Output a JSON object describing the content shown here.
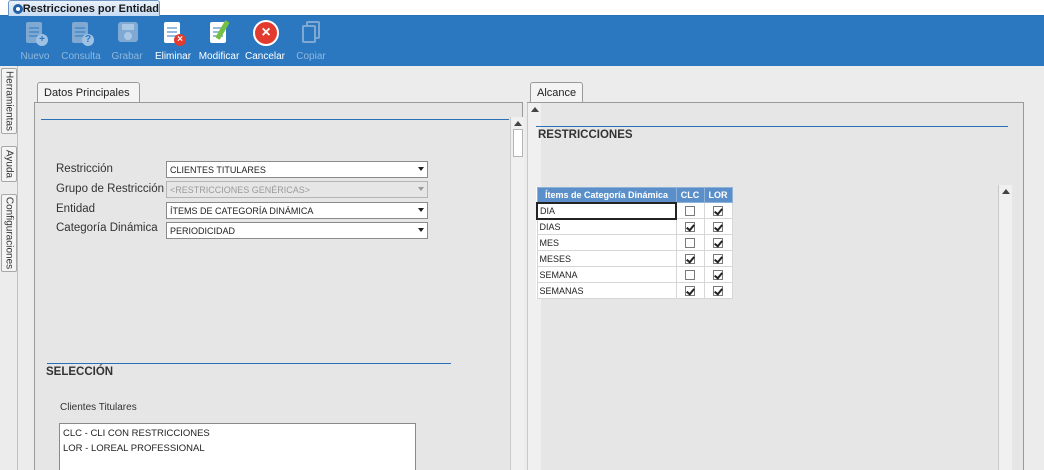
{
  "window": {
    "doc_tab_title": "Restricciones por Entidad"
  },
  "toolbar": {
    "buttons": [
      {
        "label": "Nuevo",
        "icon": "new-document-icon",
        "enabled": false
      },
      {
        "label": "Consulta",
        "icon": "query-document-icon",
        "enabled": false
      },
      {
        "label": "Grabar",
        "icon": "floppy-disk-icon",
        "enabled": false
      },
      {
        "label": "Eliminar",
        "icon": "delete-document-icon",
        "enabled": true
      },
      {
        "label": "Modificar",
        "icon": "edit-document-icon",
        "enabled": true
      },
      {
        "label": "Cancelar",
        "icon": "cancel-icon",
        "enabled": true
      },
      {
        "label": "Copiar",
        "icon": "copy-icon",
        "enabled": false
      }
    ],
    "colors": {
      "bar": "#2b78c0",
      "cancel": "#e23b2e"
    }
  },
  "side_tabs": [
    "Herramientas",
    "Ayuda",
    "Configuraciones"
  ],
  "left_panel": {
    "tab_label": "Datos Principales",
    "fields": {
      "restriccion": {
        "label": "Restricción",
        "value": "CLIENTES TITULARES"
      },
      "grupo": {
        "label": "Grupo de Restricción",
        "value": "<RESTRICCIONES GENÉRICAS>"
      },
      "entidad": {
        "label": "Entidad",
        "value": "ÍTEMS DE CATEGORÍA DINÁMICA"
      },
      "categoria": {
        "label": "Categoría Dinámica",
        "value": "PERIODICIDAD"
      }
    },
    "selection": {
      "title": "SELECCIÓN",
      "list_label": "Clientes Titulares",
      "items": [
        "CLC - CLI CON RESTRICCIONES",
        "LOR - LOREAL PROFESSIONAL"
      ]
    }
  },
  "right_panel": {
    "tab_label": "Alcance",
    "section_title": "RESTRICCIONES",
    "grid": {
      "columns": [
        "Ítems de Categoría Dinámica",
        "CLC",
        "LOR"
      ],
      "rows": [
        {
          "item": "DIA",
          "clc": false,
          "lor": true
        },
        {
          "item": "DIAS",
          "clc": true,
          "lor": true
        },
        {
          "item": "MES",
          "clc": false,
          "lor": true
        },
        {
          "item": "MESES",
          "clc": true,
          "lor": true
        },
        {
          "item": "SEMANA",
          "clc": false,
          "lor": true
        },
        {
          "item": "SEMANAS",
          "clc": true,
          "lor": true
        }
      ]
    }
  }
}
